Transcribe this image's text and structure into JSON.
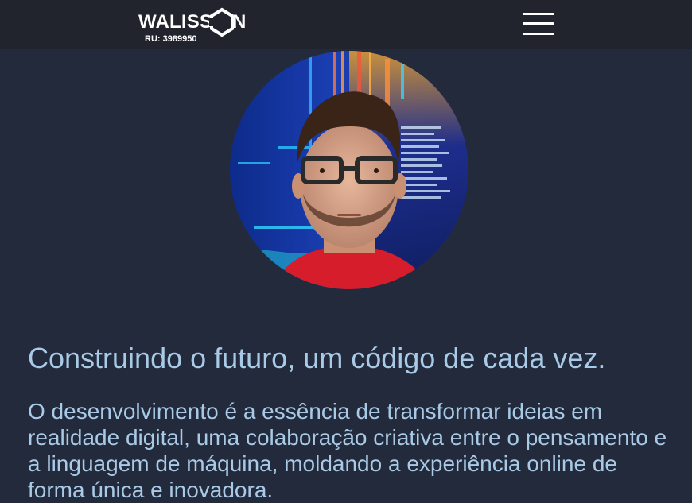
{
  "header": {
    "logo": {
      "word": "WALISS",
      "last_letter": "N",
      "ru": "RU: 3989950"
    },
    "menu_icon": "hamburger-menu-icon"
  },
  "hero": {
    "photo": "profile-photo",
    "headline": "Construindo o futuro, um código de cada vez.",
    "intro": "O desenvolvimento é a essência de transformar ideias em realidade digital, uma colaboração criativa entre o pensamento e a linguagem de máquina, moldando a experiência online de forma única e inovadora."
  },
  "colors": {
    "page_background": "#232a3c",
    "header_background": "#21242d",
    "text_accent": "#a8cae6",
    "shirt": "#d61d2c"
  }
}
